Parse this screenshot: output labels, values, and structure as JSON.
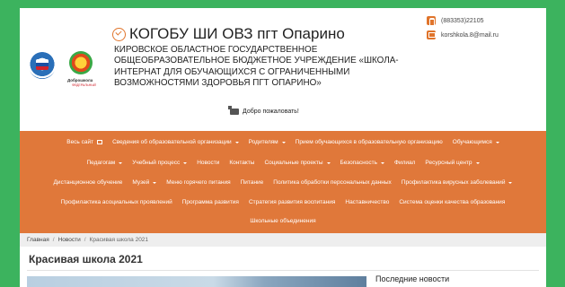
{
  "header": {
    "title": "КОГОБУ ШИ ОВЗ пгт Опарино",
    "subtitle": "КИРОВСКОЕ ОБЛАСТНОЕ ГОСУДАРСТВЕННОЕ ОБЩЕОБРАЗОВАТЕЛЬНОЕ БЮДЖЕТНОЕ УЧРЕЖДЕНИЕ «ШКОЛА-ИНТЕРНАТ ДЛЯ ОБУЧАЮЩИХСЯ С ОГРАНИЧЕННЫМИ ВОЗМОЖНОСТЯМИ ЗДОРОВЬЯ ПГТ ОПАРИНО»",
    "welcome": "Добро пожаловать!",
    "phone": "(883353)22105",
    "email": "korshkola.8@mail.ru",
    "logo2_caption": "Доброшкола",
    "logo2_sub": "ФЕДЕРАЛЬНЫЙ"
  },
  "nav": {
    "row1": [
      "Весь сайт",
      "Сведения об образовательной организации",
      "Родителям",
      "Прием обучающихся в образовательную организацию",
      "Обучающимся"
    ],
    "row2": [
      "Педагогам",
      "Учебный процесс",
      "Новости",
      "Контакты",
      "Социальные проекты",
      "Безопасность",
      "Филиал",
      "Ресурсный центр"
    ],
    "row3": [
      "Дистанционное обучение",
      "Музей",
      "Меню горячего питания",
      "Питание",
      "Политика обработки персональных данных",
      "Профилактика вирусных заболеваний"
    ],
    "row4": [
      "Профилактика асоциальных проявлений",
      "Программа развития",
      "Стратегия развития воспитания",
      "Наставничество",
      "Система оценки качества образования"
    ],
    "row5": [
      "Школьные объединения"
    ]
  },
  "breadcrumb": [
    "Главная",
    "Новости",
    "Красивая школа 2021"
  ],
  "main": {
    "title": "Красивая школа 2021",
    "sidebar_title": "Последние новости"
  },
  "colors": {
    "accent": "#e0783a",
    "background": "#3cb35e"
  },
  "icons": {
    "title": "check-circle-icon",
    "phone": "phone-icon",
    "email": "envelope-icon",
    "welcome": "megaphone-icon"
  }
}
